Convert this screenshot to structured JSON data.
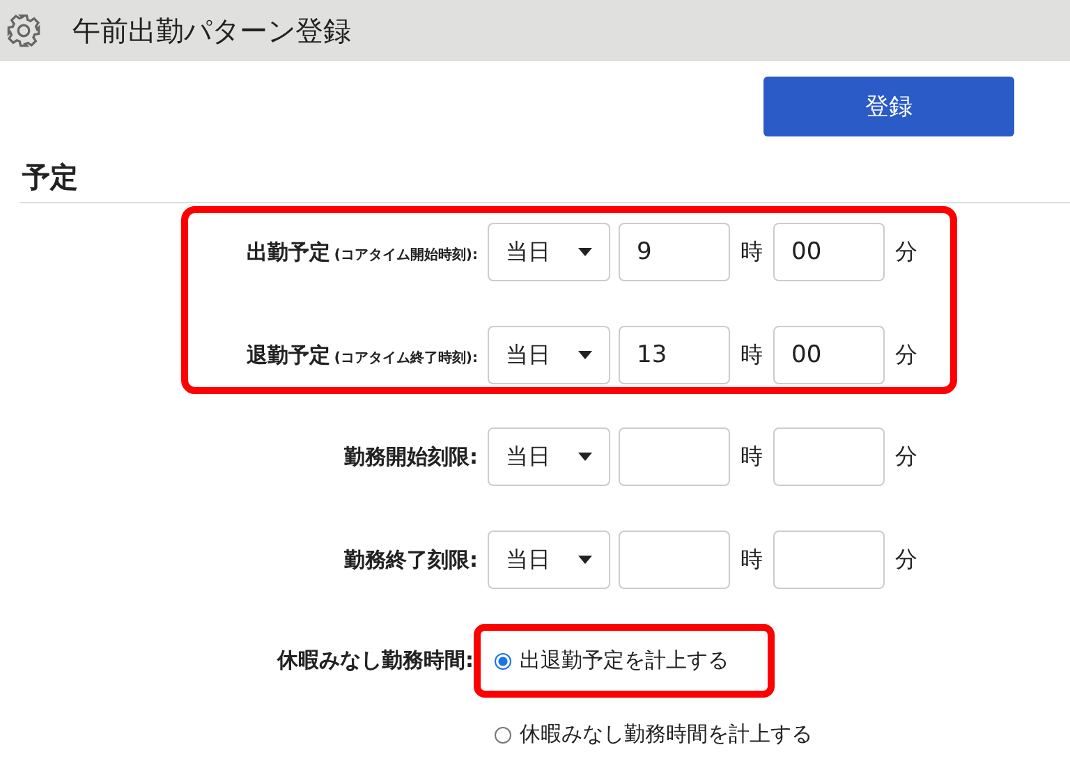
{
  "window": {
    "title": "午前出勤パターン登録"
  },
  "register_button": "登録",
  "section": {
    "title": "予定"
  },
  "groups": [
    {
      "highlighted": true,
      "rows": [
        {
          "label": "出勤予定",
          "note": "(コアタイム開始時刻):",
          "day": "当日",
          "hour": "9",
          "hour_unit": "時",
          "minute": "00",
          "minute_unit": "分"
        },
        {
          "label": "退勤予定",
          "note": "(コアタイム終了時刻):",
          "day": "当日",
          "hour": "13",
          "hour_unit": "時",
          "minute": "00",
          "minute_unit": "分"
        }
      ]
    },
    {
      "highlighted": false,
      "rows": [
        {
          "label": "勤務開始刻限:",
          "day": "当日",
          "hour_unit": "時",
          "minute_unit": "分"
        },
        {
          "label": "勤務終了刻限:",
          "day": "当日",
          "hour_unit": "時",
          "minute_unit": "分"
        }
      ]
    }
  ],
  "leave_hours": {
    "label": "休暇みなし勤務時間:",
    "options": [
      {
        "label": "出退勤予定を計上する",
        "selected": true,
        "highlighted": true
      },
      {
        "label": "休暇みなし勤務時間を計上する",
        "selected": false,
        "highlighted": false
      }
    ]
  }
}
